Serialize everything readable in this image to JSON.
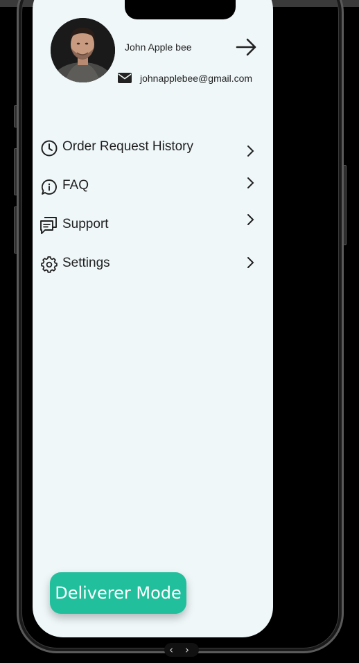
{
  "profile": {
    "name": "John Apple bee",
    "email": "johnapplebee@gmail.com"
  },
  "menu": {
    "items": [
      {
        "label": "Order Request History",
        "icon": "clock-icon"
      },
      {
        "label": "FAQ",
        "icon": "chat-info-icon"
      },
      {
        "label": "Support",
        "icon": "support-chat-icon"
      },
      {
        "label": "Settings",
        "icon": "gear-icon"
      }
    ]
  },
  "cta": {
    "label": "Deliverer Mode",
    "color": "#22bf9d"
  },
  "nav": {
    "back_glyph": "‹",
    "forward_glyph": "›"
  },
  "theme": {
    "screen_bg": "#eff7f9",
    "accent": "#22bf9d"
  }
}
